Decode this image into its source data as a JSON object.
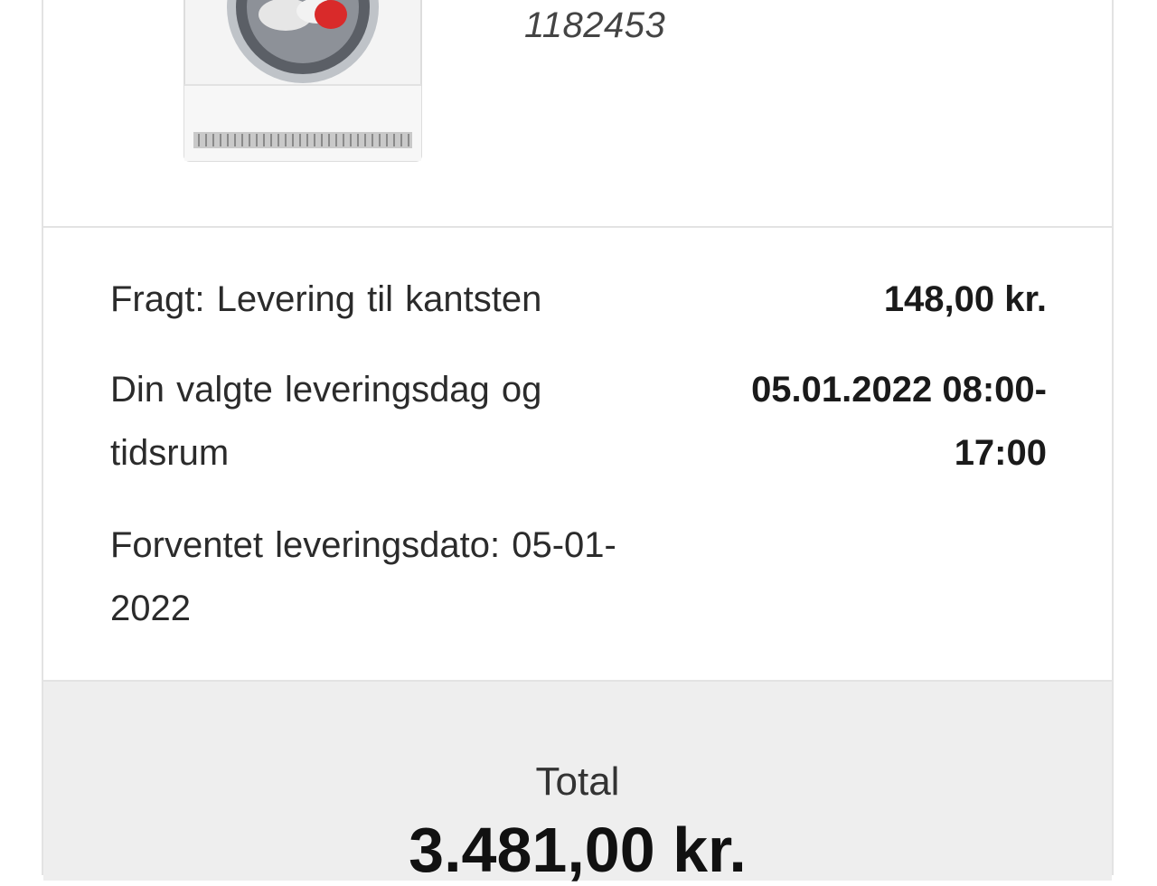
{
  "product": {
    "number": "1182453",
    "image_icon": "tumble-dryer-icon"
  },
  "shipping": {
    "freight_label": "Fragt: Levering til kantsten",
    "freight_value": "148,00 kr.",
    "delivery_slot_label": "Din valgte leveringsdag og tidsrum",
    "delivery_slot_value": "05.01.2022 08:00-17:00",
    "expected_date_label": "Forventet leveringsdato: 05-01-2022"
  },
  "total": {
    "label": "Total",
    "amount": "3.481,00 kr."
  },
  "colors": {
    "border": "#e3e3e3",
    "total_background": "#eeeeee",
    "text": "#2b2b2b"
  }
}
